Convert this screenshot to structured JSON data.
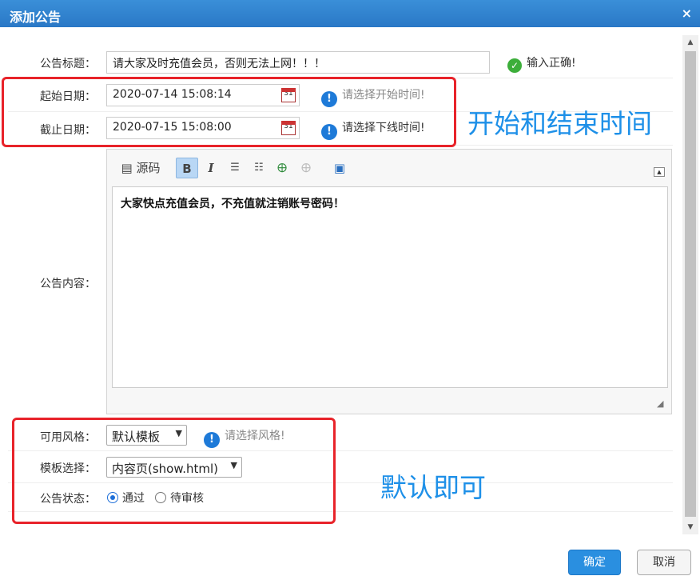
{
  "dialog": {
    "title": "添加公告",
    "close_glyph": "×"
  },
  "form": {
    "title_label": "公告标题：",
    "title_value": "请大家及时充值会员，否则无法上网！！！",
    "title_hint": "输入正确!",
    "start_label": "起始日期：",
    "start_value": "2020-07-14 15:08:14",
    "start_hint": "请选择开始时间!",
    "end_label": "截止日期：",
    "end_value": "2020-07-15 15:08:00",
    "end_hint": "请选择下线时间!",
    "content_label": "公告内容：",
    "content_value": "大家快点充值会员，不充值就注销账号密码！",
    "style_label": "可用风格：",
    "style_value": "默认模板",
    "style_hint": "请选择风格!",
    "template_label": "模板选择：",
    "template_value": "内容页(show.html)",
    "status_label": "公告状态：",
    "status_options": [
      "通过",
      "待审核"
    ],
    "status_selected": "通过"
  },
  "toolbar": {
    "source_label": "源码",
    "bold_glyph": "B",
    "italic_glyph": "I",
    "icons": [
      "source-icon",
      "bold-icon",
      "italic-icon",
      "ordered-list-icon",
      "unordered-list-icon",
      "link-icon",
      "unlink-icon",
      "maximize-icon"
    ]
  },
  "annotations": {
    "time_note": "开始和结束时间",
    "default_note": "默认即可"
  },
  "footer": {
    "ok_label": "确定",
    "cancel_label": "取消"
  },
  "colors": {
    "titlebar": "#2a78c6",
    "annotation_border": "#e8232a",
    "annotation_text": "#1e90e8",
    "primary_button": "#2a8fe0"
  }
}
